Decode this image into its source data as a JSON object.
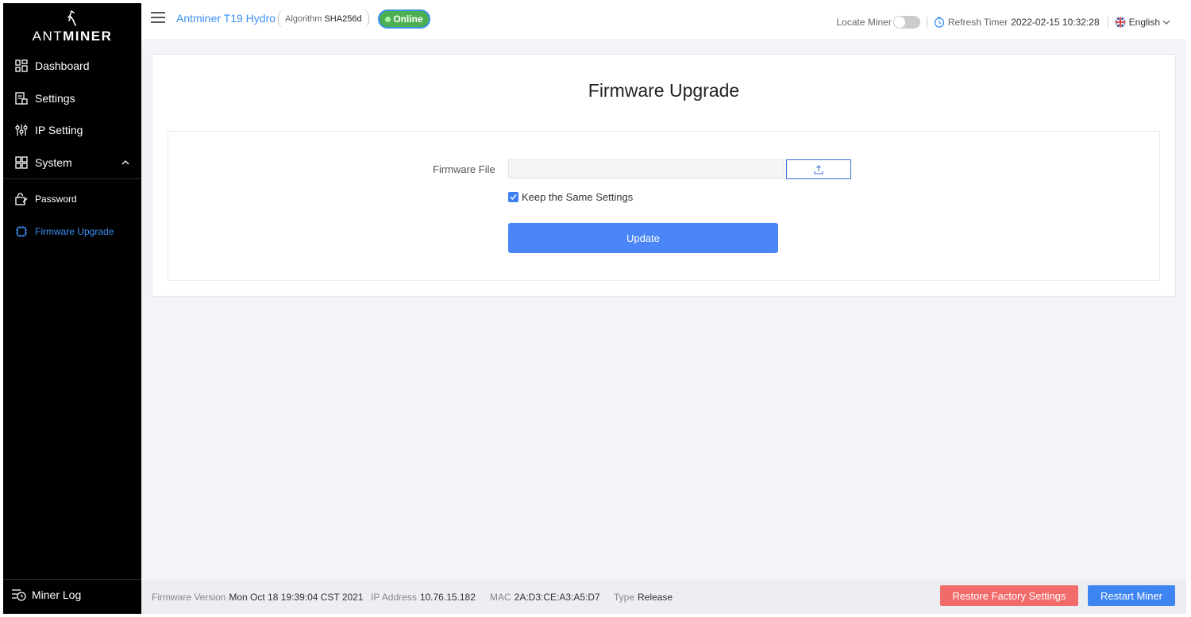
{
  "sidebar": {
    "logo_prefix": "ANT",
    "logo_suffix": "MINER",
    "items": [
      {
        "label": "Dashboard",
        "icon": "dashboard-icon"
      },
      {
        "label": "Settings",
        "icon": "settings-icon"
      },
      {
        "label": "IP Setting",
        "icon": "ip-setting-icon"
      },
      {
        "label": "System",
        "icon": "system-icon"
      }
    ],
    "sub_items": [
      {
        "label": "Password",
        "icon": "password-icon"
      },
      {
        "label": "Firmware Upgrade",
        "icon": "firmware-icon",
        "active": true
      }
    ],
    "miner_log": "Miner Log"
  },
  "header": {
    "model": "Antminer T19 Hydro",
    "algorithm_label": "Algorithm",
    "algorithm_value": "SHA256d",
    "status": "Online",
    "locate_label": "Locate Miner",
    "refresh_label": "Refresh Timer",
    "refresh_time": "2022-02-15 10:32:28",
    "language": "English"
  },
  "main": {
    "title": "Firmware Upgrade",
    "firmware_file_label": "Firmware File",
    "firmware_file_value": "",
    "keep_settings_label": "Keep the Same Settings",
    "keep_settings_checked": true,
    "update_label": "Update"
  },
  "footer": {
    "fw_version_label": "Firmware Version",
    "fw_version_value": "Mon Oct 18 19:39:04 CST 2021",
    "ip_label": "IP Address",
    "ip_value": "10.76.15.182",
    "mac_label": "MAC",
    "mac_value": "2A:D3:CE:A3:A5:D7",
    "type_label": "Type",
    "type_value": "Release",
    "restore_label": "Restore Factory Settings",
    "restart_label": "Restart Miner"
  },
  "colors": {
    "accent": "#3b8ff5",
    "online": "#4caf50",
    "danger": "#f26b6b",
    "primary_button": "#4a86f7"
  }
}
